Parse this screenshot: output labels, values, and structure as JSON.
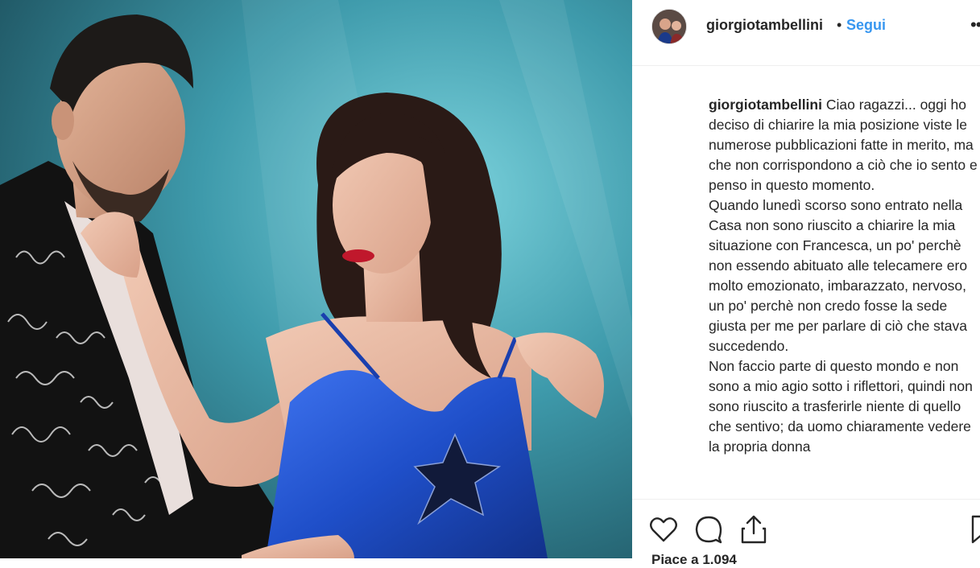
{
  "post": {
    "username": "giorgiotambellini",
    "separator": "•",
    "follow_label": "Segui",
    "more_label": "•••",
    "caption_paragraphs": [
      "Ciao ragazzi... oggi ho deciso di chiarire la mia posizione viste le numerose pubblicazioni fatte in merito, ma che non corrispondono a ciò che io sento e penso in questo momento.",
      "Quando lunedì scorso sono entrato nella Casa non sono riuscito a chiarire la mia situazione con Francesca, un po' perchè non essendo abituato alle telecamere ero molto emozionato, imbarazzato, nervoso, un po' perchè non credo fosse la sede giusta per me per parlare di ciò che stava succedendo.",
      "Non faccio parte di questo mondo e non sono a mio agio sotto i riflettori, quindi non sono riuscito a trasferirle niente di quello che sentivo; da uomo chiaramente vedere la propria donna"
    ],
    "likes_peek": "Piace a 1.094"
  },
  "icons": {
    "like": "heart-icon",
    "comment": "comment-icon",
    "share": "share-icon",
    "save": "bookmark-icon"
  },
  "colors": {
    "link": "#3897f0",
    "text": "#262626",
    "dress": "#1f4fc9",
    "background_teal": "#3a8fa0"
  }
}
